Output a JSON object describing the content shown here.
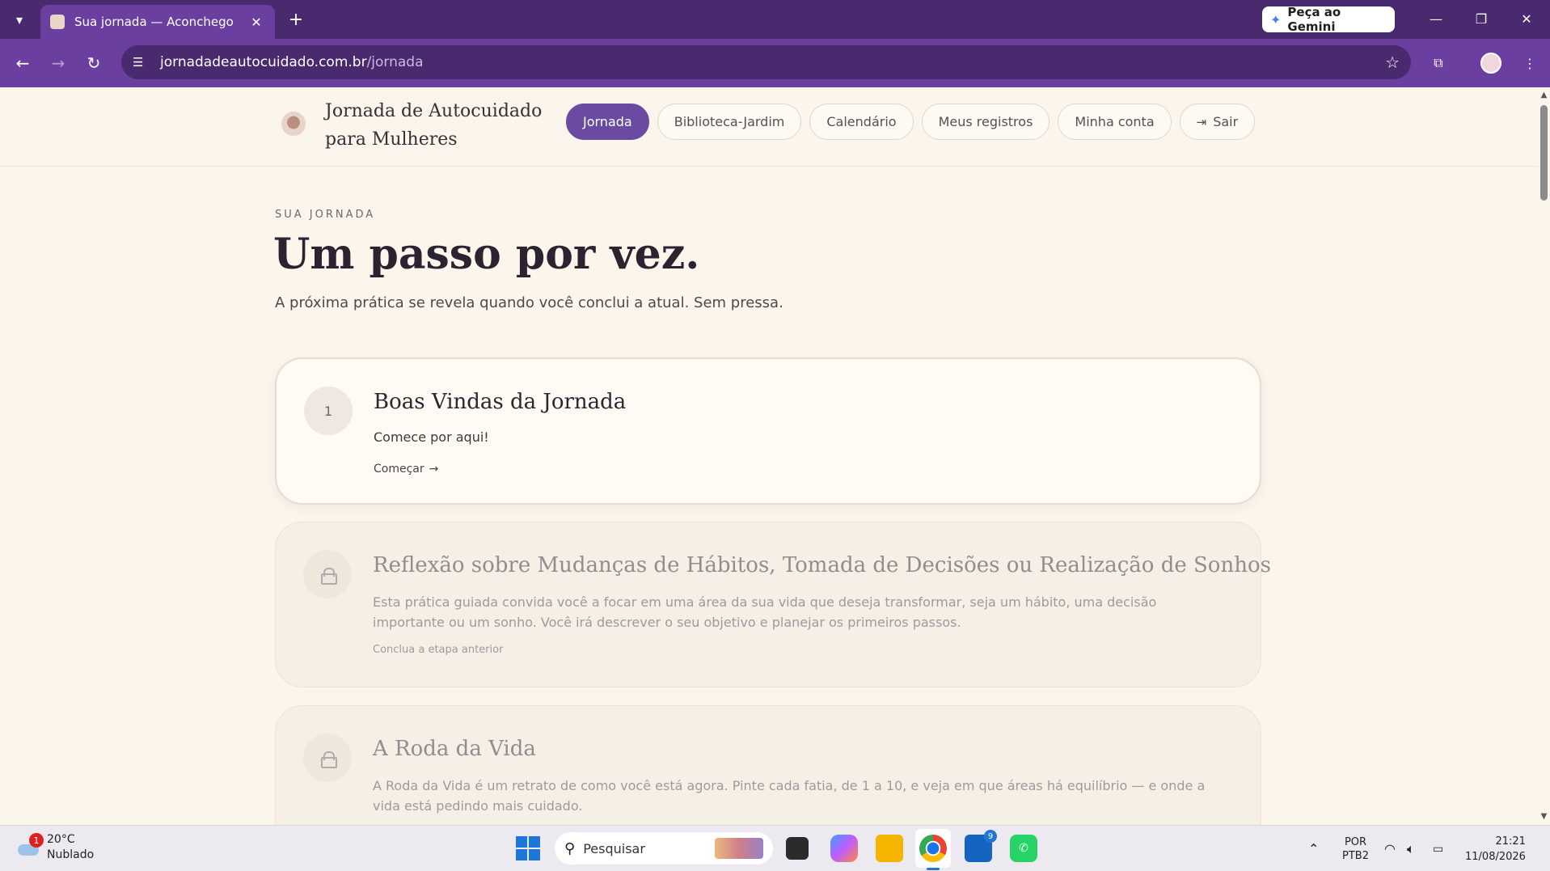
{
  "browser": {
    "tab_title": "Sua jornada — Aconchego",
    "url_host": "jornadadeautocuidado.com.br",
    "url_path": "/jornada",
    "gemini_label": "Peça ao Gemini",
    "icons": [
      "tab-list-icon",
      "close-icon",
      "plus-icon",
      "gemini-star-icon",
      "minimize-icon",
      "restore-icon",
      "window-close-icon",
      "back-icon",
      "forward-icon",
      "reload-icon",
      "site-info-icon",
      "star-icon",
      "extensions-icon",
      "avatar",
      "menu-dots-icon"
    ]
  },
  "site": {
    "brand": "Jornada de Autocuidado para Mulheres",
    "nav": [
      {
        "label": "Jornada",
        "active": true
      },
      {
        "label": "Biblioteca-Jardim",
        "active": false
      },
      {
        "label": "Calendário",
        "active": false
      },
      {
        "label": "Meus registros",
        "active": false
      },
      {
        "label": "Minha conta",
        "active": false
      },
      {
        "label": "Sair",
        "active": false
      }
    ],
    "accent_color": "#6b4aa2"
  },
  "hero": {
    "eyebrow": "SUA JORNADA",
    "title": "Um passo por vez.",
    "subtitle": "A próxima prática se revela quando você conclui a atual. Sem pressa."
  },
  "steps": [
    {
      "number": "1",
      "title": "Boas Vindas da Jornada",
      "description": "Comece por aqui!",
      "action": "Começar",
      "locked": false
    },
    {
      "title": "Reflexão sobre Mudanças de Hábitos, Tomada de Decisões ou Realização de Sonhos",
      "description": "Esta prática guiada convida você a focar em uma área da sua vida que deseja transformar, seja um hábito, uma decisão importante ou um sonho. Você irá descrever o seu objetivo e planejar os primeiros passos.",
      "action": "Conclua a etapa anterior",
      "locked": true
    },
    {
      "title": "A Roda da Vida",
      "description": "A Roda da Vida é um retrato de como você está agora. Pinte cada fatia, de 1 a 10, e veja em que áreas há equilíbrio — e onde a vida está pedindo mais cuidado.",
      "locked": true
    }
  ],
  "taskbar": {
    "weather_temp": "20°C",
    "weather_desc": "Nublado",
    "weather_alert_count": "1",
    "search_placeholder": "Pesquisar",
    "outlook_badge": "9",
    "lang_top": "POR",
    "lang_bottom": "PTB2",
    "time": "21:21",
    "date": "11/08/2026"
  }
}
